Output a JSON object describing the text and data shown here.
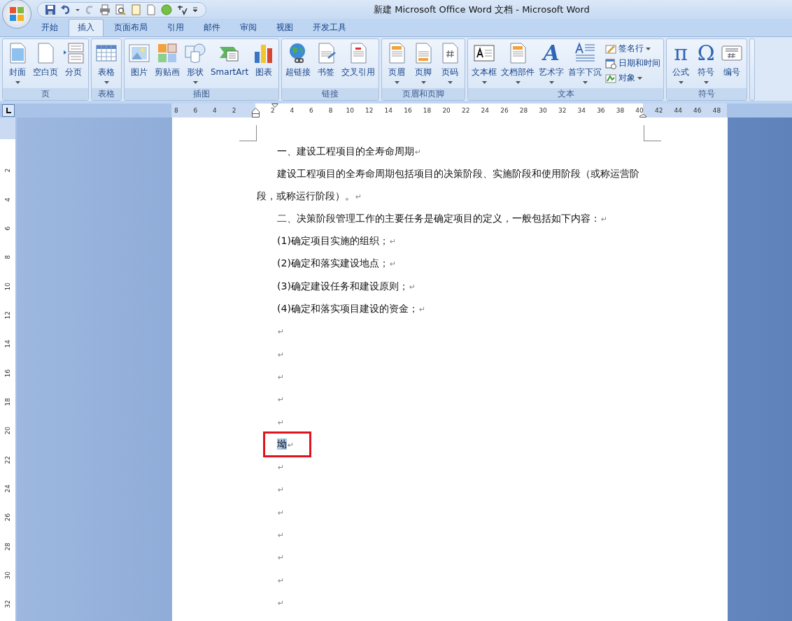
{
  "window": {
    "title": "新建 Microsoft Office Word 文档 - Microsoft Word"
  },
  "tabs": [
    {
      "label": "开始",
      "selected": false
    },
    {
      "label": "插入",
      "selected": true
    },
    {
      "label": "页面布局",
      "selected": false
    },
    {
      "label": "引用",
      "selected": false
    },
    {
      "label": "邮件",
      "selected": false
    },
    {
      "label": "审阅",
      "selected": false
    },
    {
      "label": "视图",
      "selected": false
    },
    {
      "label": "开发工具",
      "selected": false
    }
  ],
  "ribbon_groups": [
    {
      "label": "页",
      "buttons": [
        {
          "label": "封面",
          "dropdown": true
        },
        {
          "label": "空白页",
          "dropdown": false
        },
        {
          "label": "分页",
          "dropdown": false
        }
      ]
    },
    {
      "label": "表格",
      "buttons": [
        {
          "label": "表格",
          "dropdown": true
        }
      ]
    },
    {
      "label": "插图",
      "buttons": [
        {
          "label": "图片",
          "dropdown": false
        },
        {
          "label": "剪贴画",
          "dropdown": false
        },
        {
          "label": "形状",
          "dropdown": true
        },
        {
          "label": "SmartArt",
          "dropdown": false
        },
        {
          "label": "图表",
          "dropdown": false
        }
      ]
    },
    {
      "label": "链接",
      "buttons": [
        {
          "label": "超链接",
          "dropdown": false
        },
        {
          "label": "书签",
          "dropdown": false
        },
        {
          "label": "交叉引用",
          "dropdown": false
        }
      ]
    },
    {
      "label": "页眉和页脚",
      "buttons": [
        {
          "label": "页眉",
          "dropdown": true
        },
        {
          "label": "页脚",
          "dropdown": true
        },
        {
          "label": "页码",
          "dropdown": true
        }
      ]
    },
    {
      "label": "文本",
      "buttons": [
        {
          "label": "文本框",
          "dropdown": true
        },
        {
          "label": "文档部件",
          "dropdown": true
        },
        {
          "label": "艺术字",
          "dropdown": true,
          "glyph": "A"
        },
        {
          "label": "首字下沉",
          "dropdown": true
        }
      ],
      "small_buttons": [
        {
          "label": "签名行",
          "dropdown": true
        },
        {
          "label": "日期和时间",
          "dropdown": false
        },
        {
          "label": "对象",
          "dropdown": true
        }
      ]
    },
    {
      "label": "符号",
      "buttons": [
        {
          "label": "公式",
          "dropdown": true,
          "glyph": "π"
        },
        {
          "label": "符号",
          "dropdown": true,
          "glyph": "Ω"
        },
        {
          "label": "编号",
          "dropdown": false
        }
      ]
    }
  ],
  "ruler": {
    "left_numbers": [
      "8",
      "6",
      "4",
      "2"
    ],
    "right_numbers": [
      "2",
      "4",
      "6",
      "8",
      "10",
      "12",
      "14",
      "16",
      "18",
      "20",
      "22",
      "24",
      "26",
      "28",
      "30",
      "32",
      "34",
      "36",
      "38",
      "40",
      "42",
      "44",
      "46",
      "48"
    ]
  },
  "vertical_ruler": {
    "numbers": [
      "2",
      "4",
      "6",
      "8",
      "10",
      "12",
      "14",
      "16",
      "18",
      "20",
      "22",
      "24",
      "26",
      "28",
      "30",
      "32"
    ]
  },
  "document": {
    "paragraphs": [
      {
        "kind": "text",
        "text": "一、建设工程项目的全寿命周期",
        "mark": "↵",
        "selected": false
      },
      {
        "kind": "text",
        "text": "建设工程项目的全寿命周期包括项目的决策阶段、实施阶段和使用阶段（或称运营阶段，或称运行阶段）。",
        "mark": "↵",
        "selected": false
      },
      {
        "kind": "text",
        "text": "二、决策阶段管理工作的主要任务是确定项目的定义，一般包括如下内容：",
        "mark": "↵",
        "selected": false
      },
      {
        "kind": "text",
        "text": "(1)确定项目实施的组织；",
        "mark": "↵",
        "selected": false
      },
      {
        "kind": "text",
        "text": "(2)确定和落实建设地点；",
        "mark": "↵",
        "selected": false
      },
      {
        "kind": "text",
        "text": "(3)确定建设任务和建设原则；",
        "mark": "↵",
        "selected": false
      },
      {
        "kind": "text",
        "text": "(4)确定和落实项目建设的资金；",
        "mark": "↵",
        "selected": false
      },
      {
        "kind": "empty",
        "mark": "↵",
        "selected": false
      },
      {
        "kind": "empty",
        "mark": "↵",
        "selected": false
      },
      {
        "kind": "empty",
        "mark": "↵",
        "selected": false
      },
      {
        "kind": "empty",
        "mark": "↵",
        "selected": false
      },
      {
        "kind": "empty",
        "mark": "↵",
        "selected": false
      },
      {
        "kind": "text",
        "text": "坳",
        "mark": "↵",
        "selected": true,
        "annotated": true
      },
      {
        "kind": "empty",
        "mark": "↵",
        "selected": false
      },
      {
        "kind": "empty",
        "mark": "↵",
        "selected": false
      },
      {
        "kind": "empty",
        "mark": "↵",
        "selected": false
      },
      {
        "kind": "empty",
        "mark": "↵",
        "selected": false
      },
      {
        "kind": "empty",
        "mark": "↵",
        "selected": false
      },
      {
        "kind": "empty",
        "mark": "↵",
        "selected": false
      },
      {
        "kind": "empty",
        "mark": "↵",
        "selected": false
      }
    ]
  }
}
